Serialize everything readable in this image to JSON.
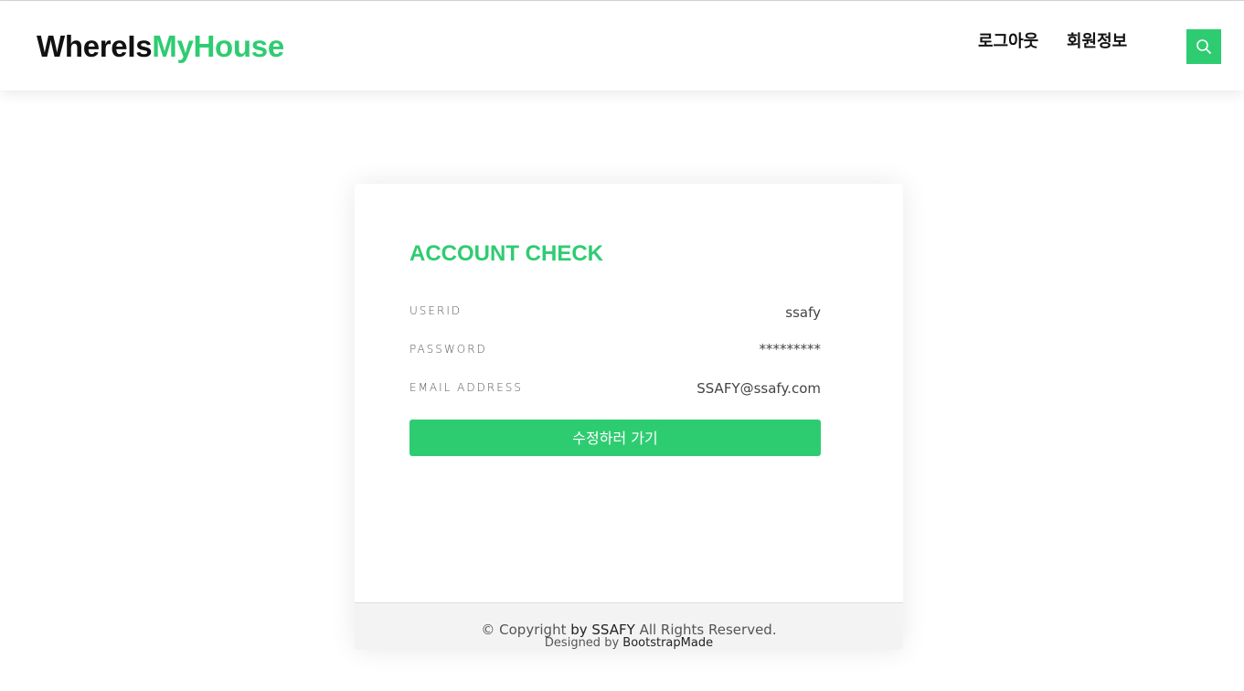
{
  "header": {
    "logo_part1": "WhereIs",
    "logo_part2": "MyHouse",
    "nav": {
      "logout": "로그아웃",
      "member_info": "회원정보"
    },
    "search_icon": "search-icon"
  },
  "account": {
    "title": "ACCOUNT CHECK",
    "fields": [
      {
        "label": "USERID",
        "value": "ssafy"
      },
      {
        "label": "PASSWORD",
        "value": "*********"
      },
      {
        "label": "EMAIL ADDRESS",
        "value": "SSAFY@ssafy.com"
      }
    ],
    "edit_button": "수정하러 가기"
  },
  "footer": {
    "copyright_prefix": "© Copyright",
    "copyright_by": "by SSAFY",
    "copyright_suffix": "All Rights Reserved.",
    "designed_by": "Designed by",
    "designer": "BootstrapMade"
  },
  "colors": {
    "accent": "#2ecc71"
  }
}
